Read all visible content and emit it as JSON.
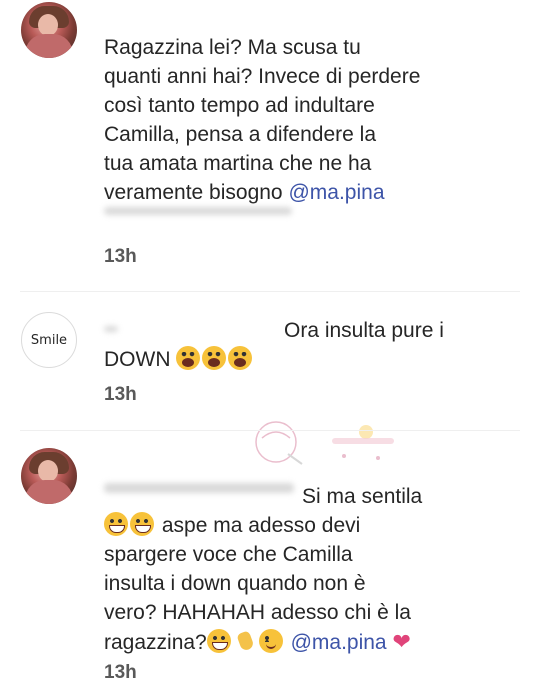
{
  "comments": [
    {
      "lines": [
        "Ragazzina lei? Ma scusa tu",
        "quanti anni hai? Invece di perdere",
        "così tanto tempo ad indultare",
        "Camilla, pensa a difendere la",
        "tua amata martina che ne ha",
        "veramente bisogno"
      ],
      "mention": "@ma.pina",
      "time": "13h"
    },
    {
      "avatar_text": "Smile",
      "line1": "Ora insulta pure i",
      "line2": "DOWN",
      "emojis": [
        "face-screaming-in-fear",
        "face-screaming-in-fear",
        "face-screaming-in-fear"
      ],
      "time": "13h"
    },
    {
      "line1": "Si ma sentila",
      "line2_after_emoji": "aspe ma adesso devi",
      "line3": "spargere voce che Camilla",
      "line4": "insulta i down quando non è",
      "line5": "vero? HAHAHAH adesso chi è la",
      "line6": "ragazzina?",
      "mention": "@ma.pina",
      "emojis_line2": [
        "grinning-squinting-face",
        "grinning-squinting-face"
      ],
      "emojis_line6": [
        "grinning-squinting-face",
        "waving-hand",
        "winking-face"
      ],
      "trailing_icon": "heart-icon",
      "time": "13h"
    }
  ],
  "colors": {
    "text": "#262626",
    "mention": "#3d54a8",
    "heart": "#e0447a",
    "time": "#595959"
  }
}
